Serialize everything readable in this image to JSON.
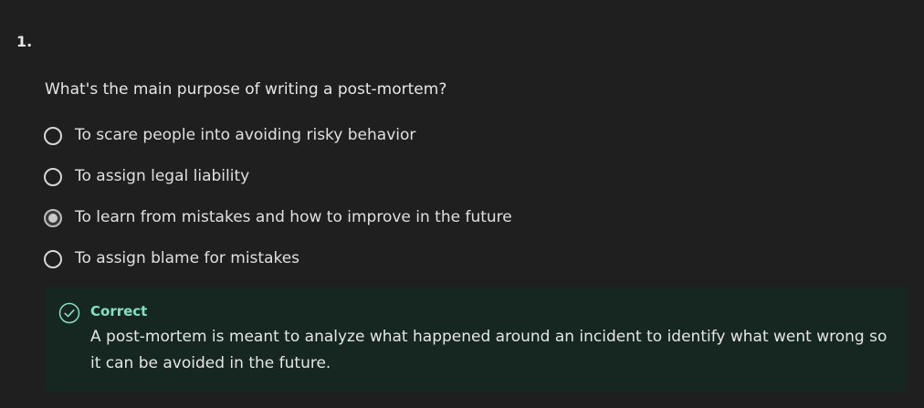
{
  "question": {
    "number": "1.",
    "text": "What's the main purpose of writing a post-mortem?",
    "options": [
      {
        "label": "To scare people into avoiding risky behavior",
        "selected": false
      },
      {
        "label": "To assign legal liability",
        "selected": false
      },
      {
        "label": "To learn from mistakes and how to improve in the future",
        "selected": true
      },
      {
        "label": "To assign blame for mistakes",
        "selected": false
      }
    ]
  },
  "feedback": {
    "status": "Correct",
    "message": "A post-mortem is meant to analyze what happened around an incident to identify what went wrong so it can be avoided in the future.",
    "icon": "check-circle-icon",
    "accent_color": "#86e0c3",
    "background_color": "#162621"
  }
}
